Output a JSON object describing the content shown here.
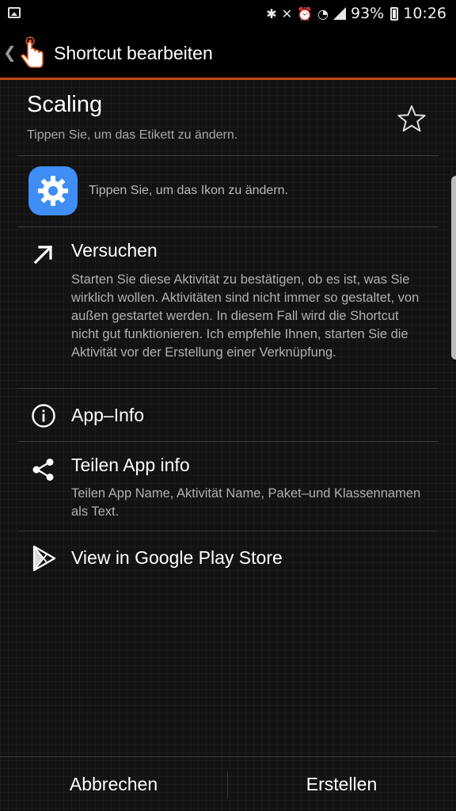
{
  "status_bar": {
    "battery": "93%",
    "time": "10:26",
    "icons": [
      "picture-icon",
      "bluetooth-icon",
      "mute-icon",
      "alarm-icon",
      "wifi-icon",
      "signal-icon",
      "battery-icon"
    ]
  },
  "toolbar": {
    "title": "Shortcut bearbeiten",
    "back_glyph": "❮"
  },
  "label": {
    "title": "Scaling",
    "hint": "Tippen Sie, um das Etikett zu ändern."
  },
  "icon_row": {
    "hint": "Tippen Sie, um das Ikon zu ändern."
  },
  "rows": [
    {
      "title": "Versuchen",
      "description": "Starten Sie diese Aktivität zu bestätigen, ob es ist, was Sie wirklich wollen. Aktivitäten sind nicht immer so gestaltet, von außen gestartet werden. In diesem Fall wird die Shortcut nicht gut funktionieren. Ich empfehle Ihnen, starten Sie die Aktivität vor der Erstellung einer Verknüpfung."
    },
    {
      "title": "App–Info"
    },
    {
      "title": "Teilen App info",
      "description": "Teilen App Name, Aktivität Name, Paket–und Klassennamen als Text."
    },
    {
      "title": "View in Google Play Store"
    }
  ],
  "bottom": {
    "cancel": "Abbrechen",
    "create": "Erstellen"
  },
  "colors": {
    "accent": "#c4491a",
    "icon_tile": "#3f8ef5",
    "background": "#121212"
  }
}
